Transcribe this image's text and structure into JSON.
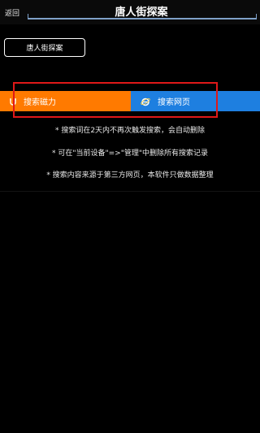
{
  "header": {
    "back_label": "返回",
    "title": "唐人街探案"
  },
  "keyword_chip": {
    "label": "唐人街探案"
  },
  "tabs": [
    {
      "label": "搜索磁力",
      "icon": "magnet-icon",
      "color": "#ff7a00"
    },
    {
      "label": "搜索网页",
      "icon": "ie-icon",
      "color": "#1e7fe0"
    }
  ],
  "notes": [
    "* 搜索词在2天内不再次触发搜索，会自动删除",
    "* 可在\"当前设备\"=>\"管理\"中删除所有搜索记录",
    "* 搜索内容来源于第三方网页，本软件只做数据整理"
  ],
  "colors": {
    "background": "#000000",
    "magnet_tab": "#ff7a00",
    "web_tab": "#1e7fe0",
    "highlight": "#e01818",
    "title_underline": "#7fa0c8"
  }
}
